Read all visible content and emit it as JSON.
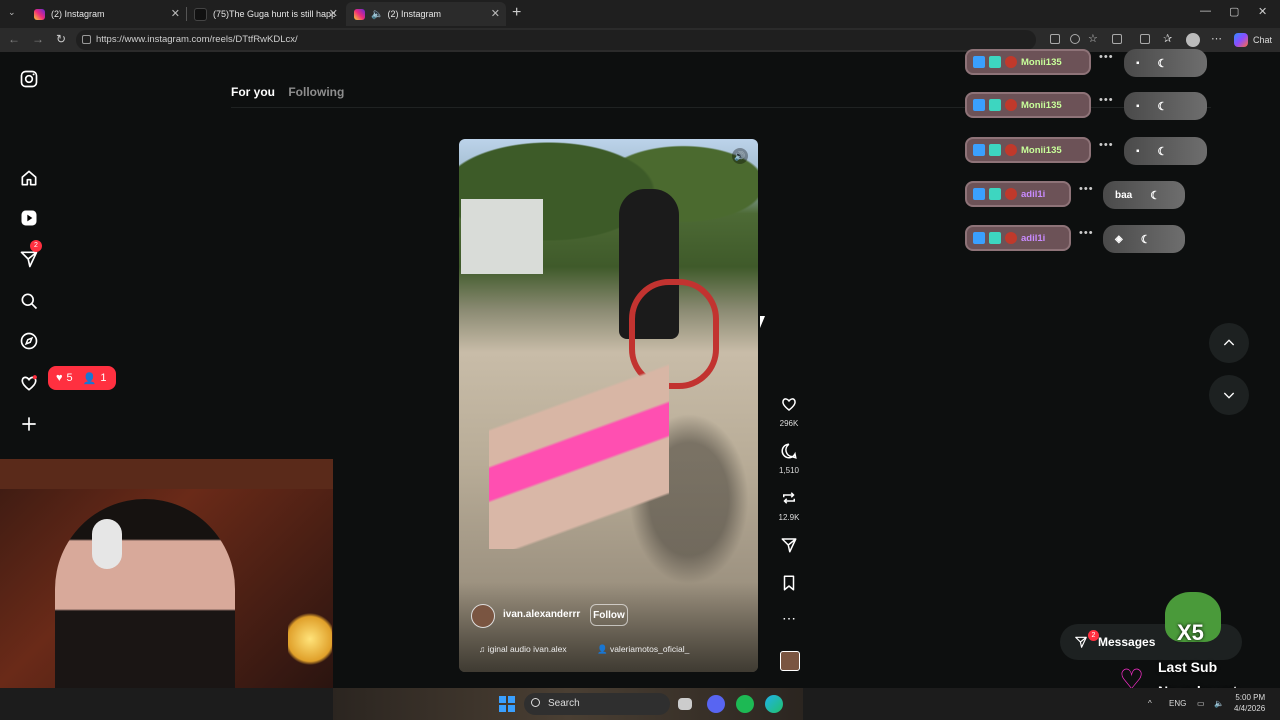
{
  "browser": {
    "tabs": [
      {
        "label": "(2) Instagram",
        "active": false
      },
      {
        "label": "(75)The Guga hunt is still happenin",
        "active": false
      },
      {
        "label": "(2) Instagram",
        "active": true
      }
    ],
    "url": "https://www.instagram.com/reels/DTtfRwKDLcx/",
    "chat_label": "Chat"
  },
  "sidebar": {
    "notifications_badge": "2",
    "activity": {
      "likes": "5",
      "follows": "1"
    }
  },
  "feed_tabs": {
    "for_you": "For you",
    "following": "Following"
  },
  "reel": {
    "owner": "ivan.alexanderrr",
    "follow_label": "Follow",
    "audio": "♫ iginal audio  ivan.alex",
    "tagged": "valeriamotos_oficial_",
    "likes": "296K",
    "comments": "1,510",
    "reposts": "12.9K"
  },
  "chat_overlay": [
    {
      "user": "Monii135",
      "reply": ""
    },
    {
      "user": "Monii135",
      "reply": ""
    },
    {
      "user": "Monii135",
      "reply": ""
    },
    {
      "user": "adil1i",
      "reply": "baa"
    },
    {
      "user": "adil1i",
      "reply": ""
    }
  ],
  "messages": {
    "label": "Messages",
    "badge": "2"
  },
  "stream_overlay": {
    "multiplier": "X5",
    "last_sub": "Last Sub",
    "no_subs": "No subs yet"
  },
  "taskbar": {
    "search_placeholder": "Search",
    "language": "ENG",
    "time": "5:00 PM",
    "date": "4/4/2026"
  },
  "colors": {
    "instagram_red": "#ff3040",
    "background": "#0d0f0f",
    "chat_pill": "#6c5257"
  }
}
